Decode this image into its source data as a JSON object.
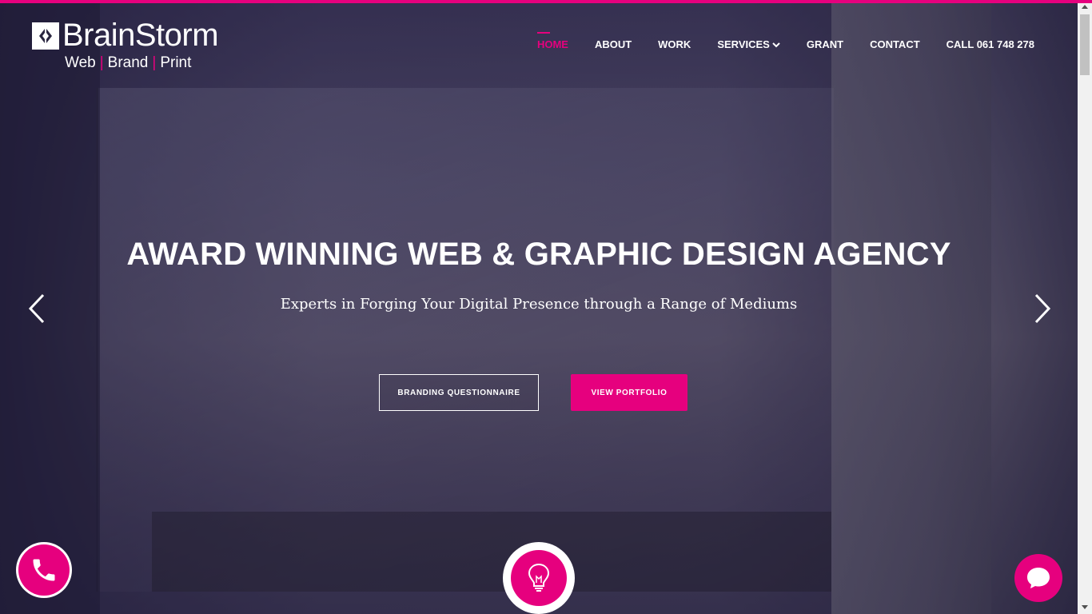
{
  "brand": {
    "name": "BrainStorm",
    "tagline_parts": [
      "Web",
      "Brand",
      "Print"
    ],
    "accent_color": "#e6007e"
  },
  "nav": {
    "items": [
      {
        "label": "HOME",
        "active": true
      },
      {
        "label": "ABOUT"
      },
      {
        "label": "WORK"
      },
      {
        "label": "SERVICES",
        "has_dropdown": true
      },
      {
        "label": "GRANT"
      },
      {
        "label": "CONTACT"
      },
      {
        "label": "CALL 061 748 278"
      }
    ]
  },
  "hero": {
    "title": "AWARD WINNING WEB & GRAPHIC DESIGN AGENCY",
    "subtitle": "Experts in Forging Your Digital Presence through a Range of Mediums",
    "buttons": {
      "questionnaire": "BRANDING QUESTIONNAIRE",
      "portfolio": "VIEW PORTFOLIO"
    }
  },
  "icons": {
    "prev": "chevron-left-icon",
    "next": "chevron-right-icon",
    "phone": "phone-icon",
    "bulb": "lightbulb-icon",
    "chat": "chat-bubble-icon",
    "dropdown": "chevron-down-icon"
  }
}
